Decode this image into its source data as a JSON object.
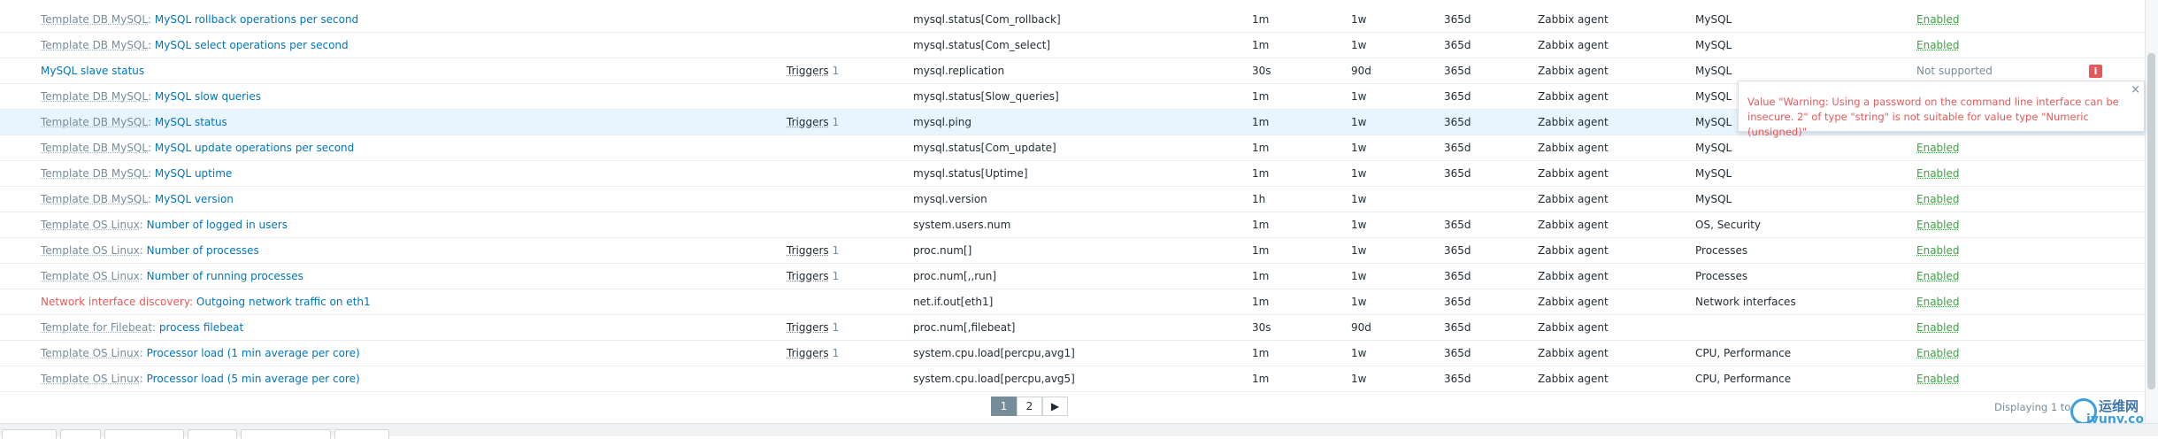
{
  "items": [
    {
      "template": "Template DB MySQL",
      "name": "MySQL rollback operations per second",
      "triggers": "",
      "triggers_count": "",
      "key": "mysql.status[Com_rollback]",
      "interval": "1m",
      "history": "1w",
      "trends": "365d",
      "type": "Zabbix agent",
      "applications": "MySQL",
      "status": "Enabled"
    },
    {
      "template": "Template DB MySQL",
      "name": "MySQL select operations per second",
      "triggers": "",
      "triggers_count": "",
      "key": "mysql.status[Com_select]",
      "interval": "1m",
      "history": "1w",
      "trends": "365d",
      "type": "Zabbix agent",
      "applications": "MySQL",
      "status": "Enabled"
    },
    {
      "template": "",
      "name": "MySQL slave status",
      "triggers": "Triggers",
      "triggers_count": "1",
      "key": "mysql.replication",
      "interval": "30s",
      "history": "90d",
      "trends": "365d",
      "type": "Zabbix agent",
      "applications": "MySQL",
      "status": "Not supported"
    },
    {
      "template": "Template DB MySQL",
      "name": "MySQL slow queries",
      "triggers": "",
      "triggers_count": "",
      "key": "mysql.status[Slow_queries]",
      "interval": "1m",
      "history": "1w",
      "trends": "365d",
      "type": "Zabbix agent",
      "applications": "MySQL",
      "status": ""
    },
    {
      "template": "Template DB MySQL",
      "name": "MySQL status",
      "triggers": "Triggers",
      "triggers_count": "1",
      "key": "mysql.ping",
      "interval": "1m",
      "history": "1w",
      "trends": "365d",
      "type": "Zabbix agent",
      "applications": "MySQL",
      "status": ""
    },
    {
      "template": "Template DB MySQL",
      "name": "MySQL update operations per second",
      "triggers": "",
      "triggers_count": "",
      "key": "mysql.status[Com_update]",
      "interval": "1m",
      "history": "1w",
      "trends": "365d",
      "type": "Zabbix agent",
      "applications": "MySQL",
      "status": "Enabled"
    },
    {
      "template": "Template DB MySQL",
      "name": "MySQL uptime",
      "triggers": "",
      "triggers_count": "",
      "key": "mysql.status[Uptime]",
      "interval": "1m",
      "history": "1w",
      "trends": "365d",
      "type": "Zabbix agent",
      "applications": "MySQL",
      "status": "Enabled"
    },
    {
      "template": "Template DB MySQL",
      "name": "MySQL version",
      "triggers": "",
      "triggers_count": "",
      "key": "mysql.version",
      "interval": "1h",
      "history": "1w",
      "trends": "",
      "type": "Zabbix agent",
      "applications": "MySQL",
      "status": "Enabled"
    },
    {
      "template": "Template OS Linux",
      "name": "Number of logged in users",
      "triggers": "",
      "triggers_count": "",
      "key": "system.users.num",
      "interval": "1m",
      "history": "1w",
      "trends": "365d",
      "type": "Zabbix agent",
      "applications": "OS, Security",
      "status": "Enabled"
    },
    {
      "template": "Template OS Linux",
      "name": "Number of processes",
      "triggers": "Triggers",
      "triggers_count": "1",
      "key": "proc.num[]",
      "interval": "1m",
      "history": "1w",
      "trends": "365d",
      "type": "Zabbix agent",
      "applications": "Processes",
      "status": "Enabled"
    },
    {
      "template": "Template OS Linux",
      "name": "Number of running processes",
      "triggers": "Triggers",
      "triggers_count": "1",
      "key": "proc.num[,,run]",
      "interval": "1m",
      "history": "1w",
      "trends": "365d",
      "type": "Zabbix agent",
      "applications": "Processes",
      "status": "Enabled"
    },
    {
      "template": "Network interface discovery",
      "name": "Outgoing network traffic on eth1",
      "triggers": "",
      "triggers_count": "",
      "key": "net.if.out[eth1]",
      "interval": "1m",
      "history": "1w",
      "trends": "365d",
      "type": "Zabbix agent",
      "applications": "Network interfaces",
      "status": "Enabled"
    },
    {
      "template": "Template for Filebeat",
      "name": "process filebeat",
      "triggers": "Triggers",
      "triggers_count": "1",
      "key": "proc.num[,filebeat]",
      "interval": "30s",
      "history": "90d",
      "trends": "365d",
      "type": "Zabbix agent",
      "applications": "",
      "status": "Enabled"
    },
    {
      "template": "Template OS Linux",
      "name": "Processor load (1 min average per core)",
      "triggers": "Triggers",
      "triggers_count": "1",
      "key": "system.cpu.load[percpu,avg1]",
      "interval": "1m",
      "history": "1w",
      "trends": "365d",
      "type": "Zabbix agent",
      "applications": "CPU, Performance",
      "status": "Enabled"
    },
    {
      "template": "Template OS Linux",
      "name": "Processor load (5 min average per core)",
      "triggers": "",
      "triggers_count": "",
      "key": "system.cpu.load[percpu,avg5]",
      "interval": "1m",
      "history": "1w",
      "trends": "365d",
      "type": "Zabbix agent",
      "applications": "CPU, Performance",
      "status": "Enabled"
    }
  ],
  "highlighted_row": 4,
  "error_row": 2,
  "discovery_row": 11,
  "separator": ": ",
  "hintbox": {
    "text": "Value \"Warning: Using a password on the command line interface can be insecure. 2\" of type \"string\" is not suitable for value type \"Numeric (unsigned)\"",
    "close_glyph": "×"
  },
  "info_icon_glyph": "i",
  "pager": {
    "pages": [
      "1",
      "2"
    ],
    "active": "1",
    "next_glyph": "▶"
  },
  "displaying_text": "Displaying 1 to",
  "watermark": {
    "line1": "运维网",
    "line2": "iyunv.com"
  },
  "colors": {
    "link": "#0275b8",
    "template": "#768d99",
    "enabled": "#429e47",
    "error": "#e45959",
    "highlight": "#e8f5ff"
  }
}
